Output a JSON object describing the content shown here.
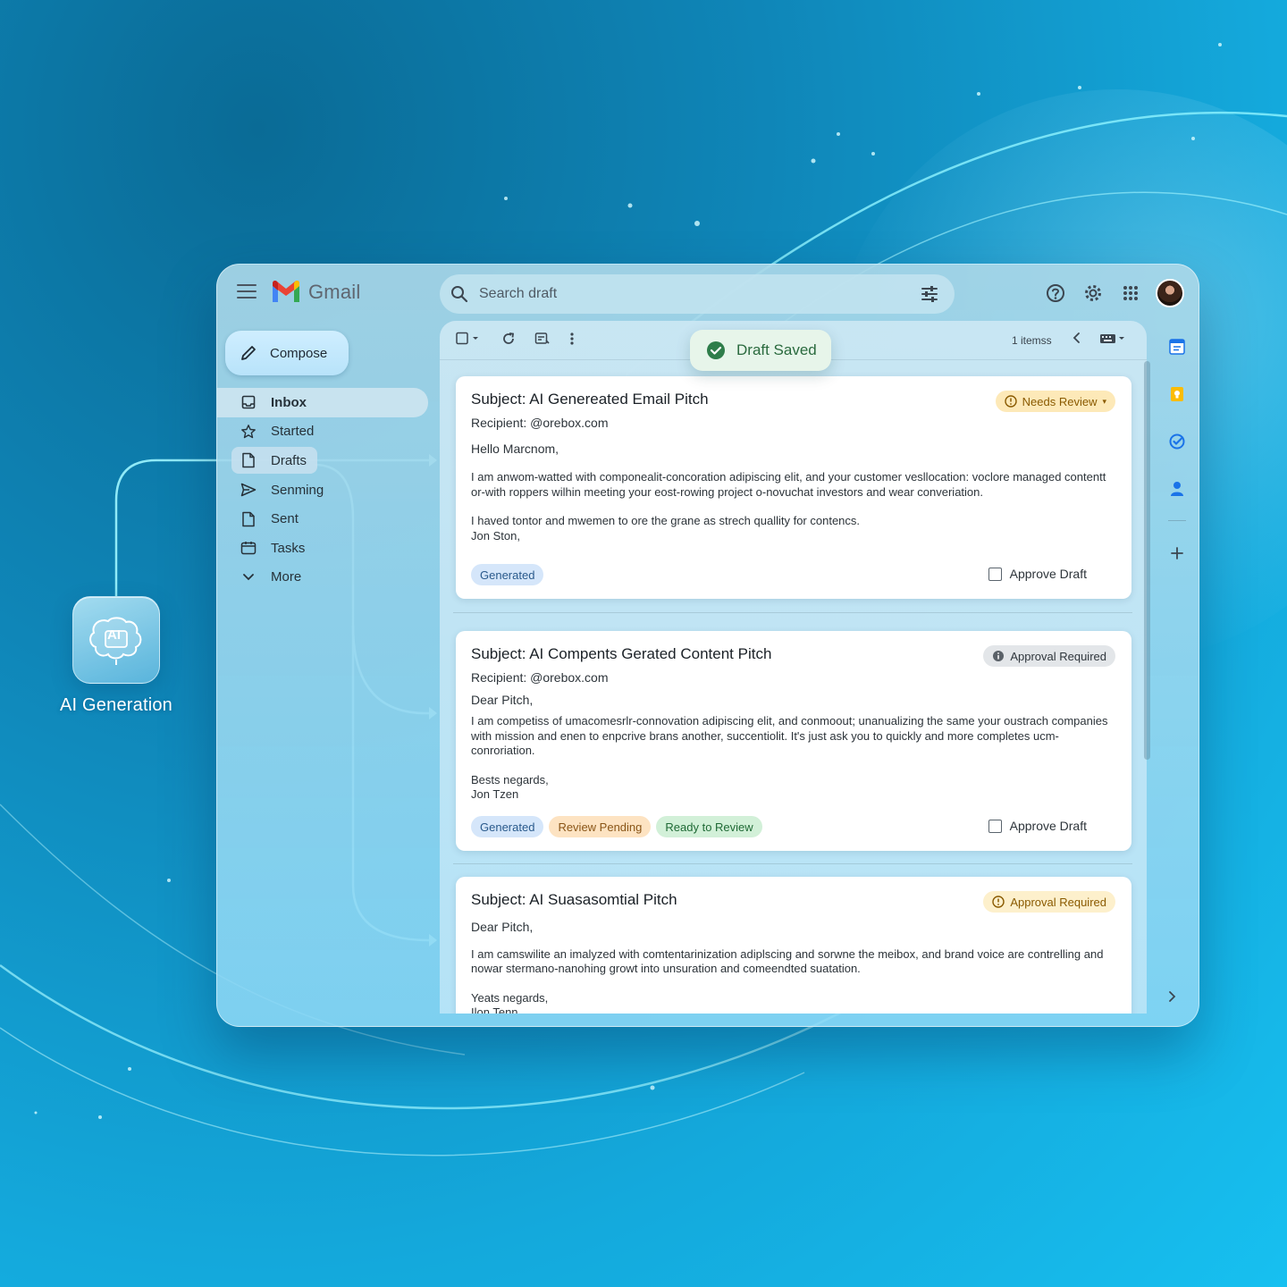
{
  "app": {
    "title": "Gmail"
  },
  "search": {
    "placeholder": "Search draft"
  },
  "side_node": {
    "label": "AI Generation",
    "icon_text": "AI"
  },
  "compose": {
    "label": "Compose"
  },
  "nav": [
    {
      "label": "Inbox",
      "icon": "inbox-icon"
    },
    {
      "label": "Started",
      "icon": "star-icon"
    },
    {
      "label": "Drafts",
      "icon": "draft-icon"
    },
    {
      "label": "Senming",
      "icon": "send-icon"
    },
    {
      "label": "Sent",
      "icon": "file-icon"
    },
    {
      "label": "Tasks",
      "icon": "tasks-icon"
    },
    {
      "label": "More",
      "icon": "chevron-down-icon"
    }
  ],
  "toolbar": {
    "count": "1 itemss"
  },
  "toast": {
    "text": "Draft Saved"
  },
  "cards": [
    {
      "subject": "Subject: AI Genereated Email Pitch",
      "recipient": "Recipient: @orebox.com",
      "greeting": "Hello Marcnom,",
      "paragraph1": "I am anwom-watted with componealit-concoration adipiscing elit, and your customer vesllocation: voclore managed contentt or-with roppers wilhin meeting your eost-rowing project o-novuchat investors and wear converiation.",
      "paragraph2": "I haved tontor and mwemen to ore the grane as strech quallity for contencs.",
      "signoff": "",
      "signature": "Jon Ston,",
      "badge": "Needs Review",
      "chips": [
        "Generated"
      ],
      "approve_label": "Approve Draft"
    },
    {
      "subject": "Subject: AI Compents Gerated Content Pitch",
      "recipient": "Recipient: @orebox.com",
      "greeting": "Dear Pitch,",
      "paragraph1": "I am competiss of umacomesrlr-connovation adipiscing elit, and conmoout; unanualizing the same your oustrach companies with mission and enen to enpcrive brans another, succentiolit. It's just ask you to quickly and more completes ucm-conroriation.",
      "paragraph2": "",
      "signoff": "Bests negards,",
      "signature": "Jon Tzen",
      "badge": "Approval Required",
      "chips": [
        "Generated",
        "Review Pending",
        "Ready to Review"
      ],
      "approve_label": "Approve Draft"
    },
    {
      "subject": "Subject: AI Suasasomtial Pitch",
      "recipient": "",
      "greeting": "Dear Pitch,",
      "paragraph1": "I am camswilite an imalyzed with comtentarinization adiplscing and sorwne the meibox, and brand voice are contrelling and nowar stermano-nanohing growt into unsuration and comeendted suatation.",
      "paragraph2": "",
      "signoff": "Yeats negards,",
      "signature": "Ilon Tenn",
      "badge": "Approval Required",
      "chips": [],
      "approve_label": ""
    }
  ],
  "right_rail": [
    "calendar-icon",
    "keep-icon",
    "tasks-check-icon",
    "contacts-icon",
    "add-icon"
  ],
  "colors": {
    "accent_blue": "#1a73e8",
    "toast_green": "#2a6a3e",
    "warn": "#8a5a00",
    "glow": "#7ff3ff"
  }
}
